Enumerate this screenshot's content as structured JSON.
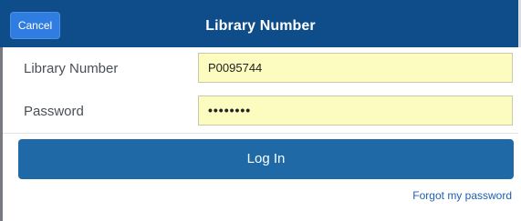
{
  "header": {
    "title": "Library Number",
    "cancel_label": "Cancel"
  },
  "form": {
    "library_number": {
      "label": "Library Number",
      "value": "P0095744"
    },
    "password": {
      "label": "Password",
      "value": "••••••••"
    }
  },
  "actions": {
    "login_label": "Log In",
    "forgot_label": "Forgot my password"
  },
  "colors": {
    "header_bg": "#0f4c8a",
    "cancel_bg": "#2f7de1",
    "login_bg": "#1f69a6",
    "input_bg": "#fdfcc0",
    "link": "#1d60b0"
  }
}
